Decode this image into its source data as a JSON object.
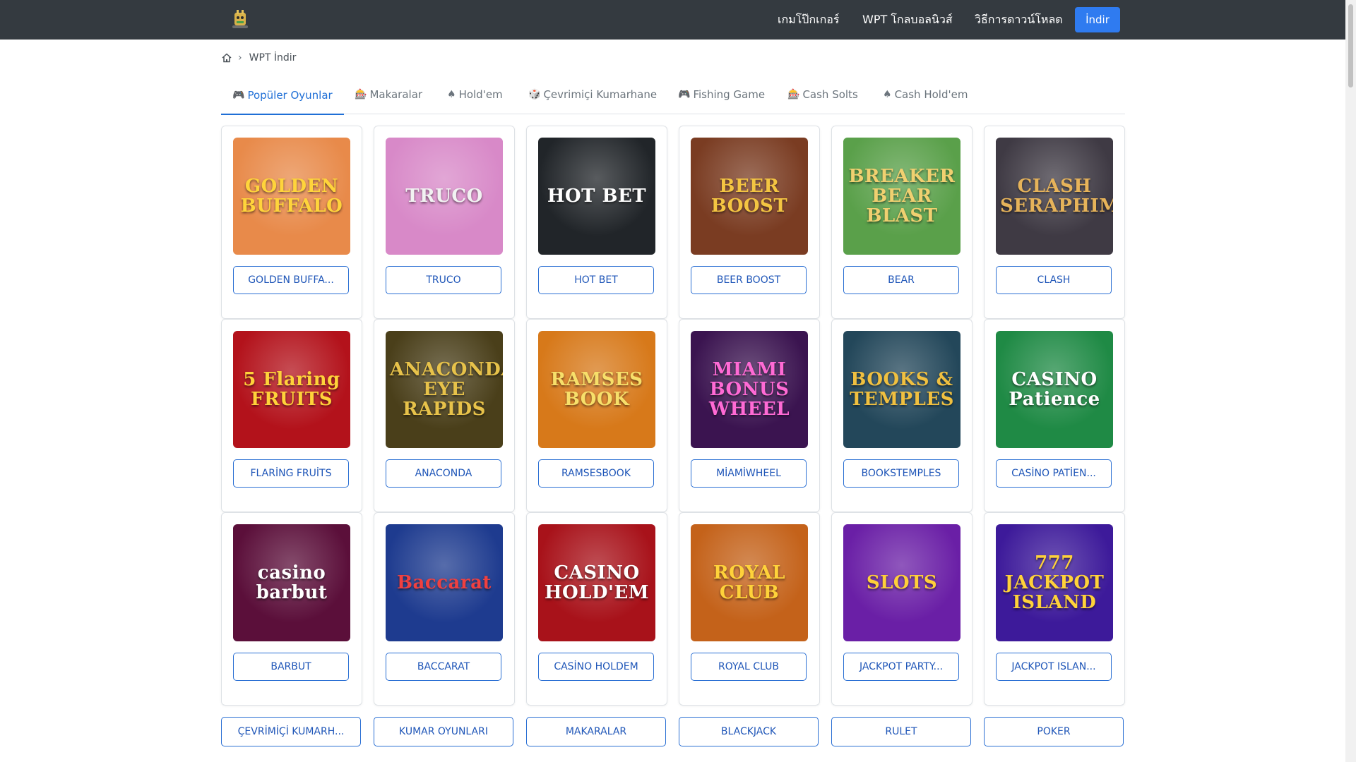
{
  "nav": {
    "links": [
      "เกมโป๊กเกอร์",
      "WPT โกลบอลนิวส์",
      "วิธีการดาวน์โหลด"
    ],
    "download_button": "İndir"
  },
  "breadcrumb": {
    "current": "WPT İndir"
  },
  "tabs": [
    {
      "icon": "🎮",
      "label": "Popüler Oyunlar"
    },
    {
      "icon": "🎰",
      "label": "Makaralar"
    },
    {
      "icon": "♠",
      "label": "Hold'em"
    },
    {
      "icon": "🎲",
      "label": "Çevrimiçi Kumarhane"
    },
    {
      "icon": "🎮",
      "label": "Fishing Game"
    },
    {
      "icon": "🎰",
      "label": "Cash Solts"
    },
    {
      "icon": "♠",
      "label": "Cash Hold'em"
    }
  ],
  "games": [
    {
      "label": "GOLDEN BUFFA...",
      "art": "GOLDEN BUFFALO",
      "bg": "#e88a4a",
      "fg": "#ffd43b"
    },
    {
      "label": "TRUCO",
      "art": "TRUCO",
      "bg": "#d889c8",
      "fg": "#f2f2f2"
    },
    {
      "label": "HOT BET",
      "art": "HOT BET",
      "bg": "#212529",
      "fg": "#ffffff"
    },
    {
      "label": "BEER BOOST",
      "art": "BEER BOOST",
      "bg": "#7a3c22",
      "fg": "#f4c542"
    },
    {
      "label": "BEAR",
      "art": "BREAKER BEAR BLAST",
      "bg": "#5aa04a",
      "fg": "#f0d070"
    },
    {
      "label": "CLASH",
      "art": "CLASH SERAPHIM",
      "bg": "#3f3a44",
      "fg": "#e6b35a"
    },
    {
      "label": "FLARİNG FRUİTS",
      "art": "5 Flaring FRUITS",
      "bg": "#b3121b",
      "fg": "#ffd23a"
    },
    {
      "label": "ANACONDA",
      "art": "ANACONDA EYE RAPIDS",
      "bg": "#4a3f1a",
      "fg": "#e7c24a"
    },
    {
      "label": "RAMSESBOOK",
      "art": "RAMSES BOOK",
      "bg": "#d7791a",
      "fg": "#f7df6a"
    },
    {
      "label": "MİAMİWHEEL",
      "art": "MIAMI BONUS WHEEL",
      "bg": "#3b1450",
      "fg": "#ff6ad5"
    },
    {
      "label": "BOOKSTEMPLES",
      "art": "BOOKS & TEMPLES",
      "bg": "#23475a",
      "fg": "#f0c040"
    },
    {
      "label": "CASİNO PATİEN...",
      "art": "CASINO Patience",
      "bg": "#1f8a45",
      "fg": "#ffffff"
    },
    {
      "label": "BARBUT",
      "art": "casino barbut",
      "bg": "#5b0f3a",
      "fg": "#ffffff"
    },
    {
      "label": "BACCARAT",
      "art": "Baccarat",
      "bg": "#1e3b8f",
      "fg": "#f04040"
    },
    {
      "label": "CASİNO HOLDEM",
      "art": "CASINO HOLD'EM",
      "bg": "#a8121a",
      "fg": "#ffffff"
    },
    {
      "label": "ROYAL CLUB",
      "art": "ROYAL CLUB",
      "bg": "#c4621a",
      "fg": "#ffd23a"
    },
    {
      "label": "JACKPOT PARTY...",
      "art": "SLOTS",
      "bg": "#6a1fa6",
      "fg": "#ffcf3a"
    },
    {
      "label": "JACKPOT ISLAN...",
      "art": "777 JACKPOT ISLAND",
      "bg": "#3d1a9a",
      "fg": "#ffd23a"
    }
  ],
  "categories": [
    "ÇEVRİMİÇİ KUMARH...",
    "KUMAR OYUNLARI",
    "MAKARALAR",
    "BLACKJACK",
    "RULET",
    "POKER"
  ]
}
